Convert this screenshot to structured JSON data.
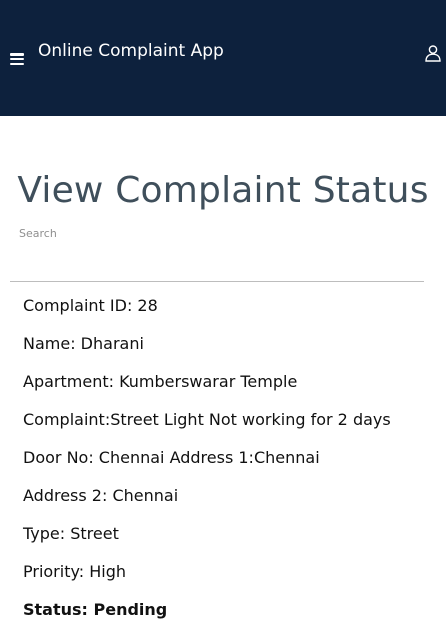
{
  "header": {
    "app_title": "Online Complaint App",
    "menu_icon": "hamburger-menu-icon",
    "user_icon": "user-icon",
    "background_color": "#0d213d"
  },
  "page": {
    "title": "View Complaint Status",
    "search_placeholder": "Search"
  },
  "complaint": {
    "id": "Complaint ID: 28",
    "name": "Name: Dharani",
    "apartment": "Apartment: Kumberswarar Temple",
    "complaint": "Complaint:Street Light Not working for 2 days",
    "address1": "Door No: Chennai Address 1:Chennai",
    "address2": "Address 2: Chennai",
    "type": "Type: Street",
    "priority": "Priority: High",
    "status": "Status: Pending"
  }
}
